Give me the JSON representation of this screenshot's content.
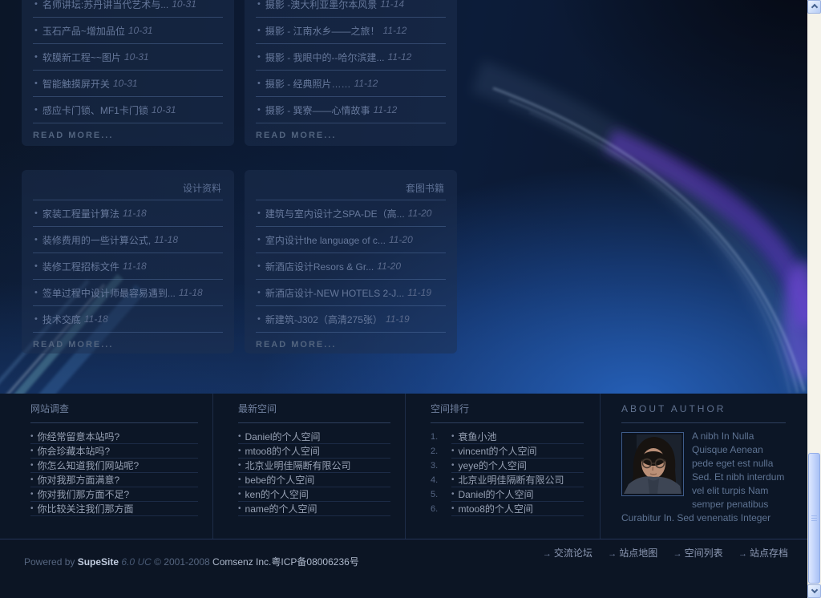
{
  "colors": {
    "accent_blue": "#1c55a8",
    "violet_streak": "#6a3fd4",
    "footer_bg": "#0c1626",
    "box_bg": "rgba(30,48,80,0.5)",
    "list_text": "#66789b",
    "footer_text": "#97a1b4",
    "scrollbar_track": "#f5f3ea",
    "scrollbar_thumb": "#c3d4fb"
  },
  "icons": {
    "arrow": "→",
    "bullet": "•"
  },
  "boxes": [
    {
      "read_more": "READ MORE...",
      "items": [
        {
          "title": "名师讲坛:苏丹讲当代艺术与...",
          "date": "10-31"
        },
        {
          "title": "玉石产品~增加品位",
          "date": "10-31"
        },
        {
          "title": "软膜新工程~~图片",
          "date": "10-31"
        },
        {
          "title": "智能触摸屏开关",
          "date": "10-31"
        },
        {
          "title": "感应卡门锁、MF1卡门锁",
          "date": "10-31"
        }
      ]
    },
    {
      "read_more": "READ MORE...",
      "items": [
        {
          "title": "摄影 -澳大利亚墨尔本风景",
          "date": "11-14"
        },
        {
          "title": "摄影 - 江南水乡——之旅！",
          "date": "11-12"
        },
        {
          "title": "摄影 - 我眼中的--哈尔滨建...",
          "date": "11-12"
        },
        {
          "title": "摄影 - 经典照片……",
          "date": "11-12"
        },
        {
          "title": "摄影 - 巽寮——心情故事",
          "date": "11-12"
        }
      ]
    },
    {
      "header": "设计资料",
      "read_more": "READ MORE...",
      "items": [
        {
          "title": "家装工程量计算法",
          "date": "11-18"
        },
        {
          "title": "装修费用的一些计算公式,",
          "date": "11-18"
        },
        {
          "title": "装修工程招标文件",
          "date": "11-18"
        },
        {
          "title": "签单过程中设计师最容易遇到...",
          "date": "11-18"
        },
        {
          "title": "技术交底",
          "date": "11-18"
        }
      ]
    },
    {
      "header": "套图书籍",
      "read_more": "READ MORE...",
      "items": [
        {
          "title": "建筑与室内设计之SPA-DE（高...",
          "date": "11-20"
        },
        {
          "title": "室内设计the language of c...",
          "date": "11-20"
        },
        {
          "title": "新酒店设计Resors & Gr...",
          "date": "11-20"
        },
        {
          "title": "新酒店设计-NEW HOTELS 2-J...",
          "date": "11-19"
        },
        {
          "title": "新建筑-J302（高清275张）",
          "date": "11-19"
        }
      ]
    }
  ],
  "footer": {
    "survey": {
      "title": "网站调查",
      "items": [
        "你经常留意本站吗?",
        "你会珍藏本站吗?",
        "你怎么知道我们网站呢?",
        "你对我那方面满意?",
        "你对我们那方面不足?",
        "你比较关注我们那方面"
      ]
    },
    "latest_spaces": {
      "title": "最新空间",
      "items": [
        "Daniel的个人空间",
        "mtoo8的个人空间",
        "北京业明佳隔断有限公司",
        "bebe的个人空间",
        "ken的个人空间",
        "name的个人空间"
      ]
    },
    "ranking": {
      "title": "空间排行",
      "items": [
        {
          "rank": "1.",
          "label": "衰鱼小池"
        },
        {
          "rank": "2.",
          "label": "vincent的个人空间"
        },
        {
          "rank": "3.",
          "label": "yeye的个人空间"
        },
        {
          "rank": "4.",
          "label": "北京业明佳隔断有限公司"
        },
        {
          "rank": "5.",
          "label": "Daniel的个人空间"
        },
        {
          "rank": "6.",
          "label": "mtoo8的个人空间"
        }
      ]
    },
    "about": {
      "title": "ABOUT AUTHOR",
      "text": "A nibh In Nulla Quisque Aenean pede eget est nulla Sed. Et nibh interdum vel elit turpis Nam semper penatibus Curabitur In. Sed venenatis Integer"
    }
  },
  "bottombar": {
    "powered_prefix": "Powered by",
    "brand": "SupeSite",
    "version": "6.0 UC",
    "copyright": "© 2001-2008",
    "company": "Comsenz Inc.",
    "icp": "粤ICP备08006236号",
    "links": [
      "交流论坛",
      "站点地图",
      "空间列表",
      "站点存档"
    ]
  }
}
